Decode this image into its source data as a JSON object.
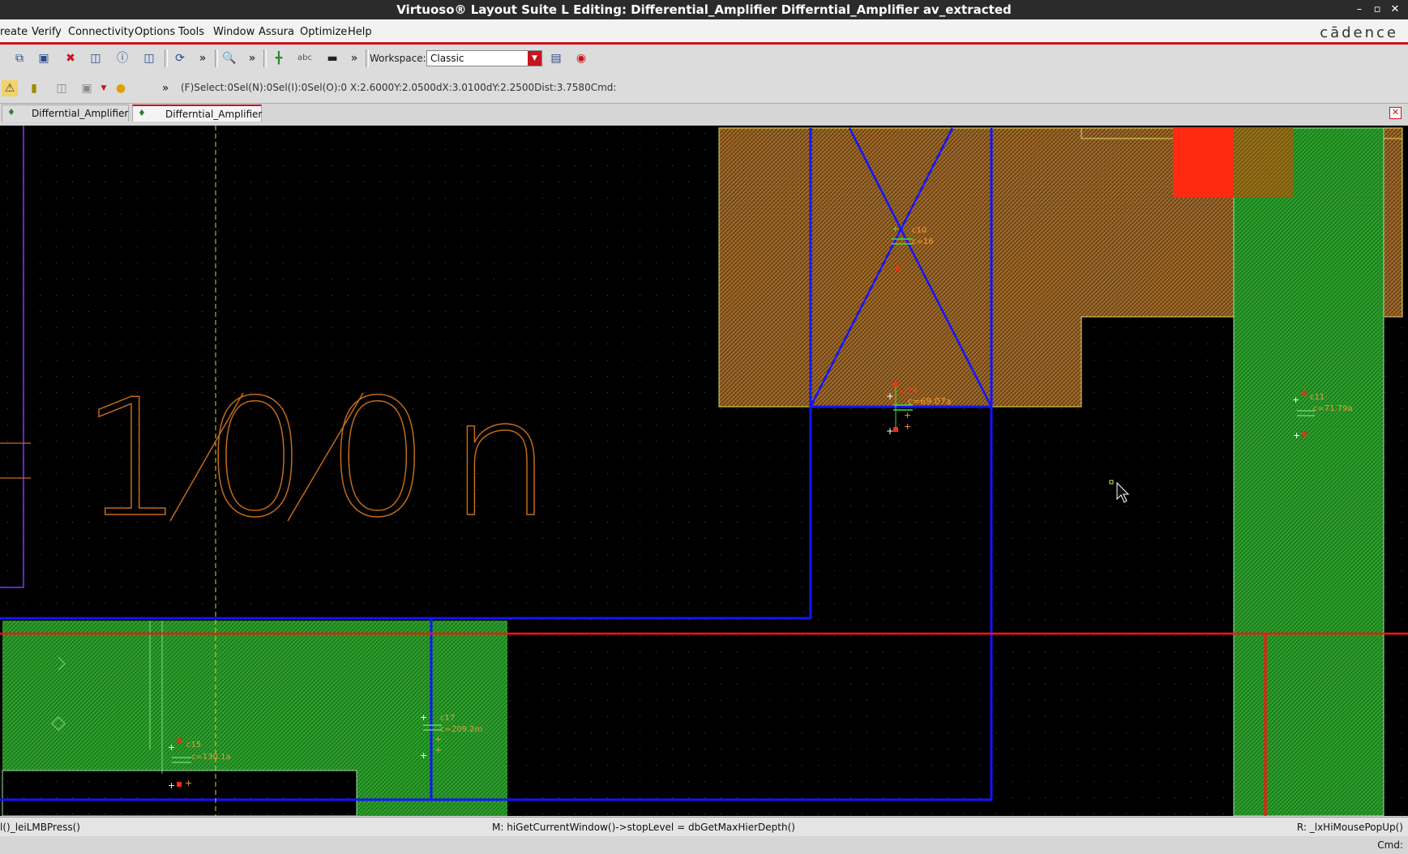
{
  "window": {
    "title": "Virtuoso® Layout Suite L Editing: Differential_Amplifier Differntial_Amplifier av_extracted"
  },
  "menu": {
    "items": [
      "reate",
      "Verify",
      "Connectivity",
      "Options",
      "Tools",
      "Window",
      "Assura",
      "Optimize",
      "Help"
    ],
    "logo": "cādence"
  },
  "toolbar": {
    "workspace_label": "Workspace:",
    "workspace_value": "Classic",
    "more_label": "»"
  },
  "status": {
    "text": "(F)Select:0Sel(N):0Sel(I):0Sel(O):0  X:2.6000Y:2.0500dX:3.0100dY:2.2500Dist:3.7580Cmd:"
  },
  "tabs": [
    {
      "label": "Differntial_Amplifier",
      "active": false
    },
    {
      "label": "Differntial_Amplifier",
      "active": true
    }
  ],
  "canvas": {
    "big_label": "100n",
    "capacitors": [
      {
        "name": "c10",
        "value": "c=16"
      },
      {
        "name": "c24",
        "value": "c=69.07a"
      },
      {
        "name": "c11",
        "value": "c=71.79a"
      },
      {
        "name": "c17",
        "value": "c=209.2m"
      },
      {
        "name": "c15",
        "value": "c=130.1a"
      }
    ]
  },
  "bottom": {
    "left": "l()_leiLMBPress()",
    "middle": "M: hiGetCurrentWindow()->stopLevel = dbGetMaxHierDepth()",
    "right": "R: _lxHiMousePopUp()"
  },
  "cmd": {
    "label": "Cmd:"
  },
  "colors": {
    "title_bg": "#2b2b2b",
    "accent_red": "#c8141e",
    "canvas_bg": "#000000",
    "poly_blue": "#1414ff",
    "metal_green": "#1f8a1f",
    "diff_orange": "#b06a1e"
  }
}
